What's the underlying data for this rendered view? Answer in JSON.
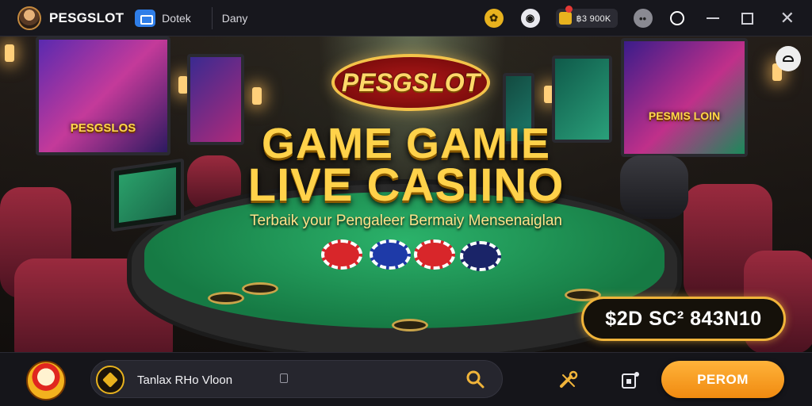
{
  "topbar": {
    "brand": "PESGSLOT",
    "nav_label": "Dotek",
    "nav_label_2": "Dany",
    "wallet_value": "฿3 900K",
    "icons": [
      "coin-icon",
      "globe-icon",
      "wallet-icon",
      "menu-dots-icon",
      "ring-icon",
      "minimize-icon",
      "maximize-icon",
      "close-icon"
    ]
  },
  "hero": {
    "logo_text": "PESGSLOT",
    "title_line1": "GAME GAMIE",
    "title_line2": "LIVE CASIINO",
    "subtitle": "Terbaik your Pengaleer Bermaiy Mensenaiglan",
    "screens": [
      "PESGSLOS",
      "PESMIS LOIN"
    ],
    "promo_badge": "$2D SC² 843N10",
    "accent_color": "#ffd24a"
  },
  "bottombar": {
    "search_value": "Tanlax RHo Vloon",
    "play_button": "PEROM",
    "accent_color": "#f39a1c"
  }
}
